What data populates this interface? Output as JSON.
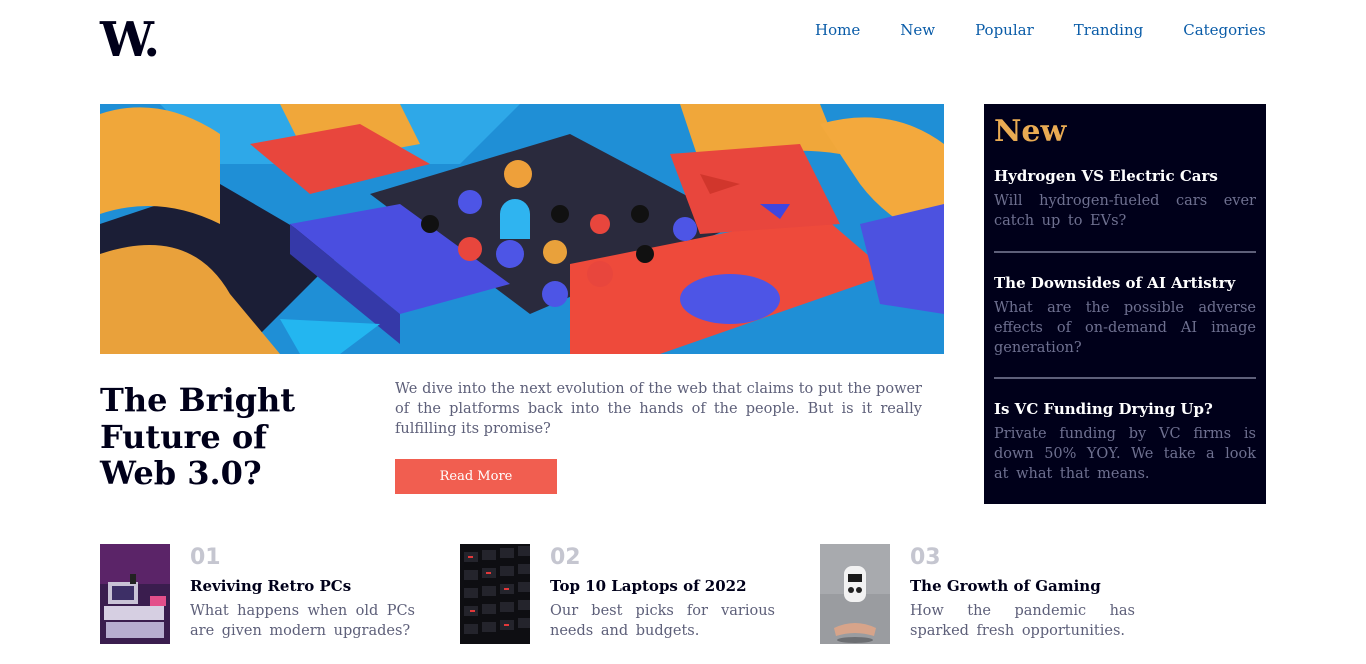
{
  "logo": {
    "text": "W."
  },
  "nav": {
    "items": [
      "Home",
      "New",
      "Popular",
      "Tranding",
      "Categories"
    ]
  },
  "hero": {
    "image_alt": "colorful 3d geometric blocks and pegs",
    "headline": "The Bright Future of Web 3.0?",
    "teaser": "We dive into the next evolution of the web that claims to put the power of the platforms back into the hands of the people. But is it really fulfilling its promise?",
    "read_more_label": "Read More"
  },
  "new_panel": {
    "title": "New",
    "items": [
      {
        "title": "Hydrogen VS Electric Cars",
        "desc": "Will hydrogen-fueled cars ever catch up to EVs?"
      },
      {
        "title": "The Downsides of AI Artistry",
        "desc": "What are the possible adverse effects of on-demand AI image generation?"
      },
      {
        "title": "Is VC Funding Drying Up?",
        "desc": "Private funding by VC firms is down 50% YOY. We take a look at what that means."
      }
    ]
  },
  "bottom": {
    "cards": [
      {
        "num": "01",
        "title": "Reviving Retro PCs",
        "desc": "What happens when old PCs are given modern upgrades?"
      },
      {
        "num": "02",
        "title": "Top 10 Laptops of 2022",
        "desc": "Our best picks for various needs and budgets."
      },
      {
        "num": "03",
        "title": "The Growth of Gaming",
        "desc": "How the pandemic has sparked fresh opportunities."
      }
    ]
  },
  "colors": {
    "navy": "#00001a",
    "accent": "#f15e50",
    "gold": "#e9ab53",
    "link": "#0a5ca8",
    "muted": "#5d5f79"
  }
}
